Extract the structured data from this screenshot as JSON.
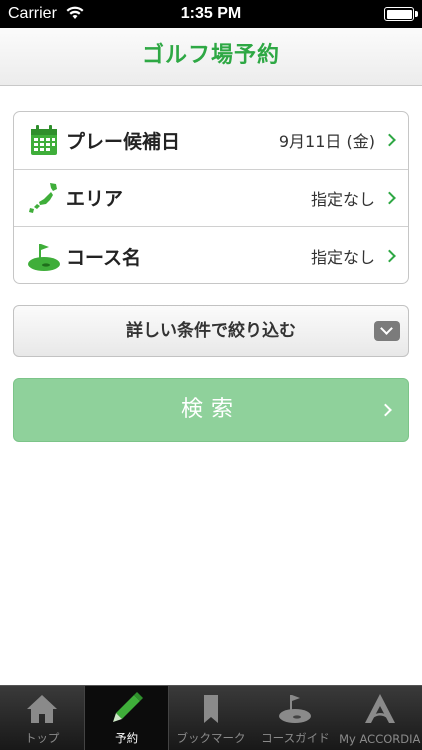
{
  "status_bar": {
    "carrier": "Carrier",
    "time": "1:35 PM"
  },
  "nav": {
    "title": "ゴルフ場予約"
  },
  "options": [
    {
      "label": "プレー候補日",
      "value": "9月11日 (金)",
      "icon": "calendar-icon"
    },
    {
      "label": "エリア",
      "value": "指定なし",
      "icon": "japan-map-icon"
    },
    {
      "label": "コース名",
      "value": "指定なし",
      "icon": "golf-green-icon"
    }
  ],
  "refine": {
    "label": "詳しい条件で絞り込む",
    "icon": "dropdown-icon"
  },
  "search": {
    "label": "検索"
  },
  "tabs": [
    {
      "label": "トップ",
      "icon": "home-icon"
    },
    {
      "label": "予約",
      "icon": "pencil-icon",
      "active": true
    },
    {
      "label": "ブックマーク",
      "icon": "bookmark-icon"
    },
    {
      "label": "コースガイド",
      "icon": "golf-course-icon"
    },
    {
      "label": "My ACCORDIA",
      "icon": "accordia-logo-icon"
    }
  ],
  "colors": {
    "accent": "#2ea844",
    "search_button": "#8fd19b",
    "tab_bar": "#222222"
  }
}
